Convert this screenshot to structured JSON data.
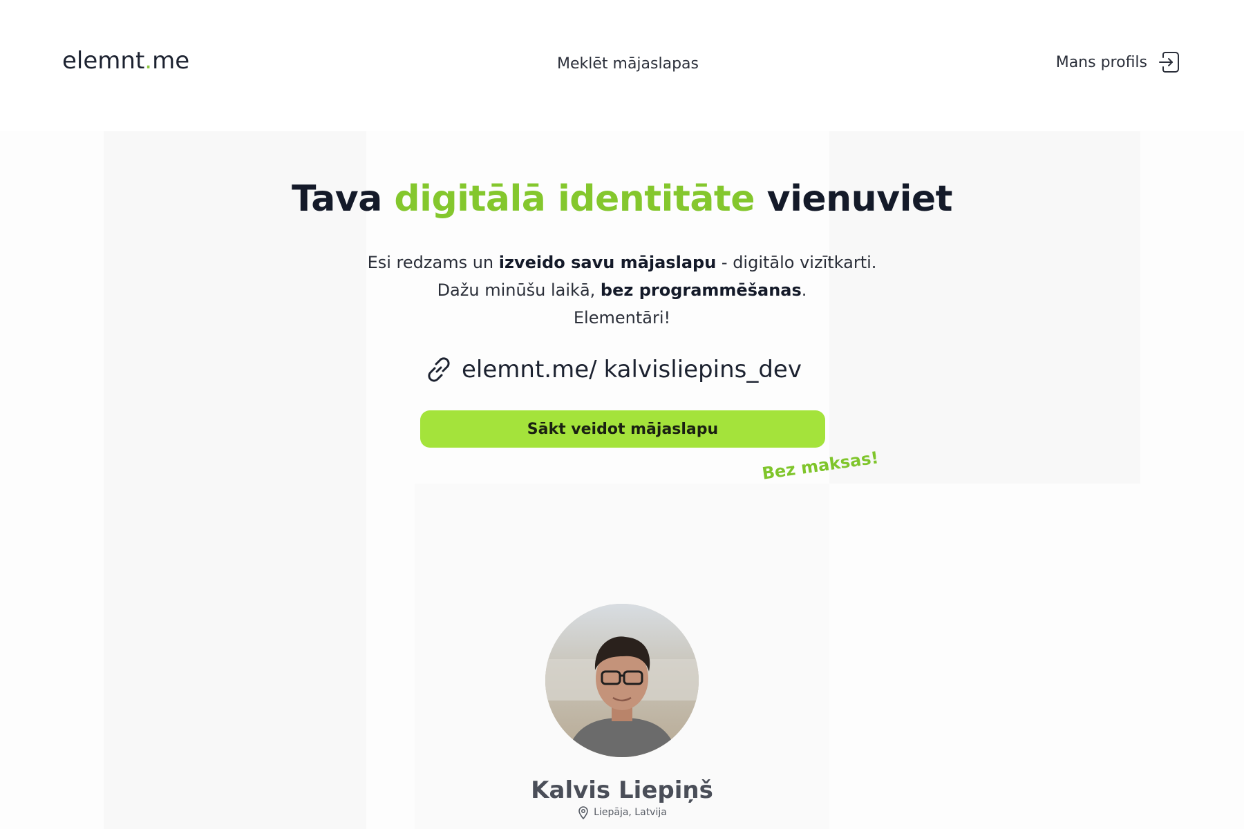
{
  "header": {
    "logo_main": "elemnt",
    "logo_dot": ".",
    "logo_tld": "me",
    "nav_search": "Meklēt mājaslapas",
    "nav_profile": "Mans profils",
    "profile_icon": "login-icon"
  },
  "hero": {
    "title_part1": "Tava ",
    "title_highlight": "digitālā identitāte",
    "title_part2": " vienuviet",
    "line1_a": "Esi redzams un ",
    "line1_bold": "izveido savu mājaslapu",
    "line1_b": " - digitālo vizītkarti.",
    "line2_a": "Dažu minūšu laikā, ",
    "line2_bold": "bez programmēšanas",
    "line2_b": ".",
    "line3": "Elementāri!"
  },
  "url_input": {
    "icon": "link-icon",
    "prefix": "elemnt.me/",
    "value": "kalvisliepins_dev"
  },
  "cta": {
    "label": "Sākt veidot mājaslapu",
    "badge": "Bez maksas!"
  },
  "profile_preview": {
    "name": "Kalvis Liepiņš",
    "location": "Liepāja, Latvija",
    "location_icon": "map-pin-icon"
  },
  "colors": {
    "accent": "#a4e33b",
    "accent_text": "#84c72d",
    "text_dark": "#141a29"
  }
}
